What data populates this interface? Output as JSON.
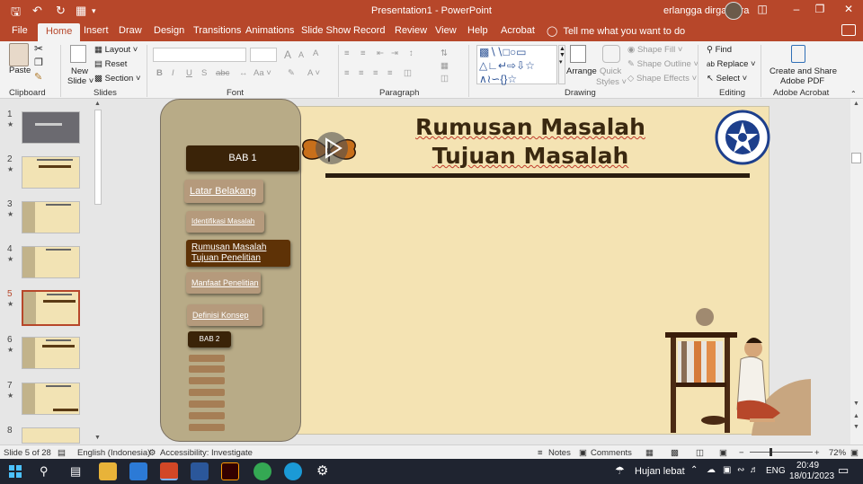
{
  "titlebar": {
    "doc_title": "Presentation1  -  PowerPoint",
    "user_name": "erlangga dirgantara",
    "minimize": "–",
    "restore": "❐",
    "close": "✕",
    "ribbon_display": "◫"
  },
  "tabs": [
    "File",
    "Home",
    "Insert",
    "Draw",
    "Design",
    "Transitions",
    "Animations",
    "Slide Show",
    "Record",
    "Review",
    "View",
    "Help",
    "Acrobat"
  ],
  "active_tab": "Home",
  "tell_me": "Tell me what you want to do",
  "ribbon": {
    "clipboard": {
      "paste": "Paste",
      "label": "Clipboard"
    },
    "slides": {
      "new_slide_1": "New",
      "new_slide_2": "Slide ˅",
      "layout": "Layout ˅",
      "reset": "Reset",
      "section": "Section ˅",
      "label": "Slides"
    },
    "font": {
      "label": "Font",
      "bold": "B",
      "italic": "I",
      "underline": "U",
      "shadow": "S",
      "strike": "abc",
      "size_up": "A",
      "size_down": "A",
      "case": "Aa ˅",
      "clear": "A",
      "color": "A ˅"
    },
    "paragraph": {
      "label": "Paragraph"
    },
    "drawing": {
      "arrange": "Arrange",
      "quick_styles_1": "Quick",
      "quick_styles_2": "Styles ˅",
      "shape_fill": "Shape Fill ˅",
      "shape_outline": "Shape Outline ˅",
      "shape_effects": "Shape Effects ˅",
      "label": "Drawing"
    },
    "editing": {
      "find": "Find",
      "replace": "Replace ˅",
      "select": "Select ˅",
      "label": "Editing"
    },
    "acrobat": {
      "create_1": "Create and Share",
      "create_2": "Adobe PDF",
      "label": "Adobe Acrobat"
    }
  },
  "slide_numbers": [
    "1",
    "2",
    "3",
    "4",
    "5",
    "6",
    "7",
    "8"
  ],
  "slide": {
    "bab1": "BAB 1",
    "latar": "Latar Belakang",
    "identifikasi": "Identifikasi Masalah",
    "rumusan_1": "Rumusan Masalah",
    "rumusan_2": "Tujuan Penelitian",
    "manfaat": "Manfaat Penelitian",
    "definisi": "Definisi Konsep",
    "bab2": "BAB 2",
    "title_1": "Rumusan Masalah",
    "title_2": "Tujuan Masalah"
  },
  "statusbar": {
    "slide_of": "Slide 5 of 28",
    "language": "English (Indonesia)",
    "accessibility": "Accessibility: Investigate",
    "notes": "Notes",
    "comments": "Comments",
    "zoom": "72%"
  },
  "taskbar": {
    "weather": "Hujan lebat",
    "lang": "ENG",
    "time": "20:49",
    "date": "18/01/2023"
  },
  "colors": {
    "accent": "#b7472a",
    "slide_bg": "#f4e3b3",
    "nav_dark": "#3a2308"
  }
}
